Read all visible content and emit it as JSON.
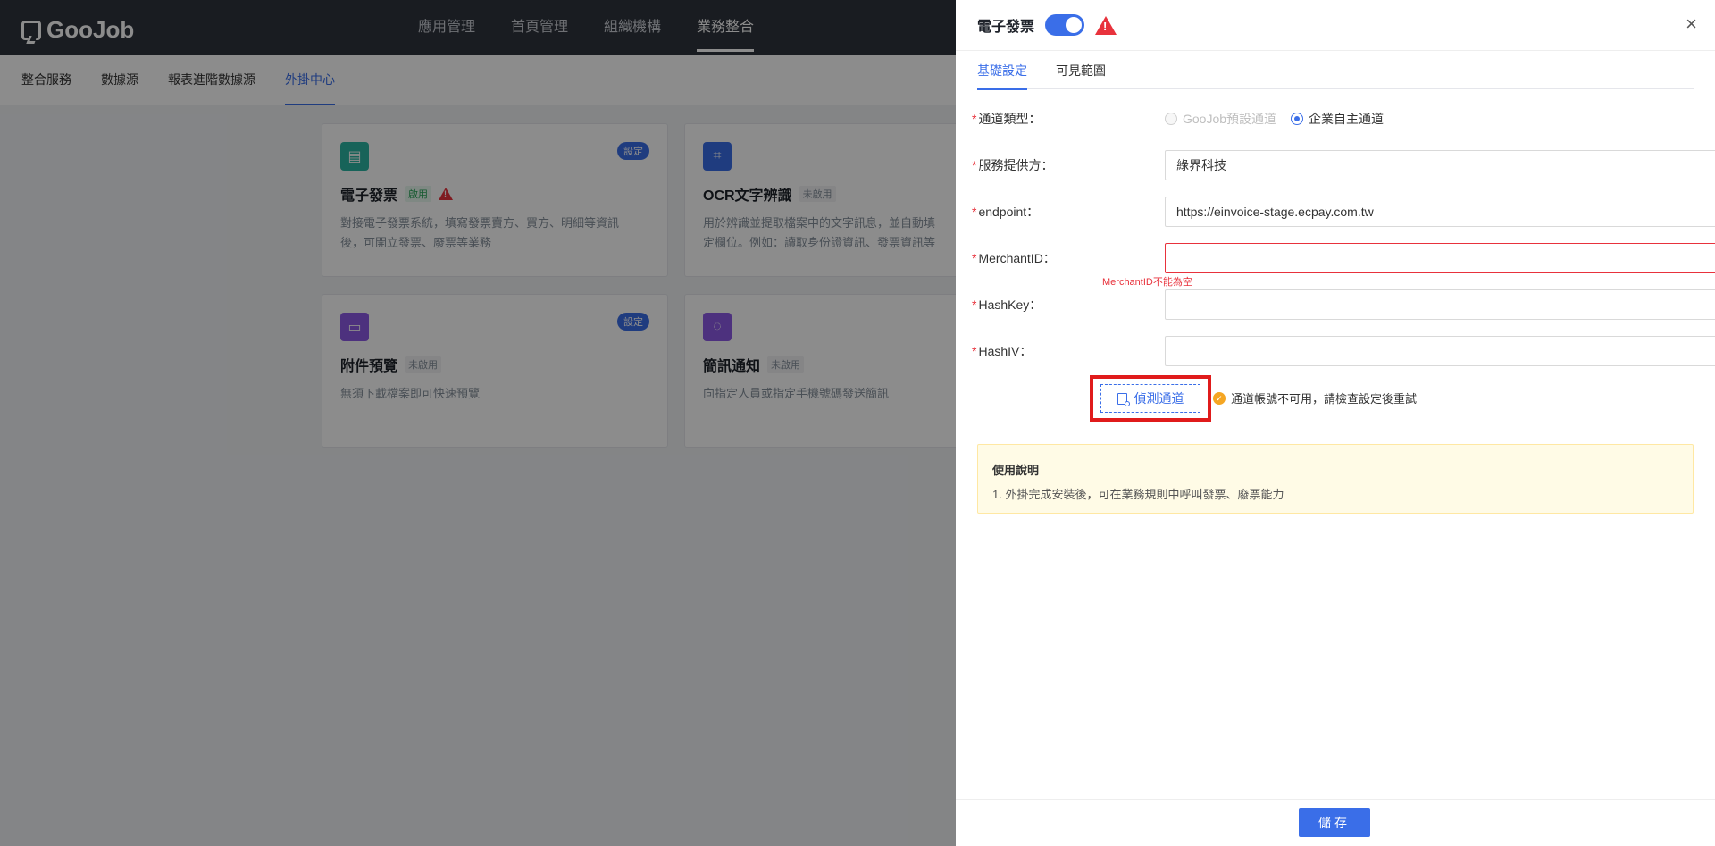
{
  "app": {
    "logo_text": "GooJob"
  },
  "topnav": {
    "items": [
      "應用管理",
      "首頁管理",
      "組織機構",
      "業務整合"
    ]
  },
  "subnav": {
    "items": [
      "整合服務",
      "數據源",
      "報表進階數據源",
      "外掛中心"
    ]
  },
  "cards": [
    {
      "title": "電子發票",
      "status": "啟用",
      "badge": "設定",
      "desc1": "對接電子發票系統，填寫發票賣方、買方、明細等資訊",
      "desc2": "後，可開立發票、廢票等業務"
    },
    {
      "title": "OCR文字辨識",
      "status": "未啟用",
      "desc1": "用於辨識並提取檔案中的文字訊息，並自動填",
      "desc2": "定欄位。例如：讀取身份證資訊、發票資訊等"
    },
    {
      "title": "附件預覽",
      "status": "未啟用",
      "badge": "設定",
      "desc1": "無須下載檔案即可快速預覽"
    },
    {
      "title": "簡訊通知",
      "status": "未啟用",
      "desc1": "向指定人員或指定手機號碼發送簡訊"
    }
  ],
  "drawer": {
    "title": "電子發票",
    "toggle_on": true,
    "close": "×",
    "tabs": [
      "基礎設定",
      "可見範圍"
    ],
    "form": {
      "channel_type_label": "通道類型：",
      "channel_opt1": "GooJob預設通道",
      "channel_opt2": "企業自主通道",
      "provider_label": "服務提供方：",
      "provider_value": "綠界科技",
      "endpoint_label": "endpoint：",
      "endpoint_value": "https://einvoice-stage.ecpay.com.tw",
      "merchant_label": "MerchantID：",
      "merchant_value": "",
      "merchant_error": "MerchantID不能為空",
      "hashkey_label": "HashKey：",
      "hashkey_value": "",
      "hashiv_label": "HashIV：",
      "hashiv_value": ""
    },
    "detect_button": "偵測通道",
    "detect_status": "通道帳號不可用，請檢查設定後重試",
    "help_title": "使用說明",
    "help_text": "1. 外掛完成安裝後，可在業務規則中呼叫發票、廢票能力",
    "save_button": "儲存"
  },
  "colors": {
    "accent": "#3a6ee8",
    "error": "#e8323c",
    "warning": "#f5a623"
  }
}
